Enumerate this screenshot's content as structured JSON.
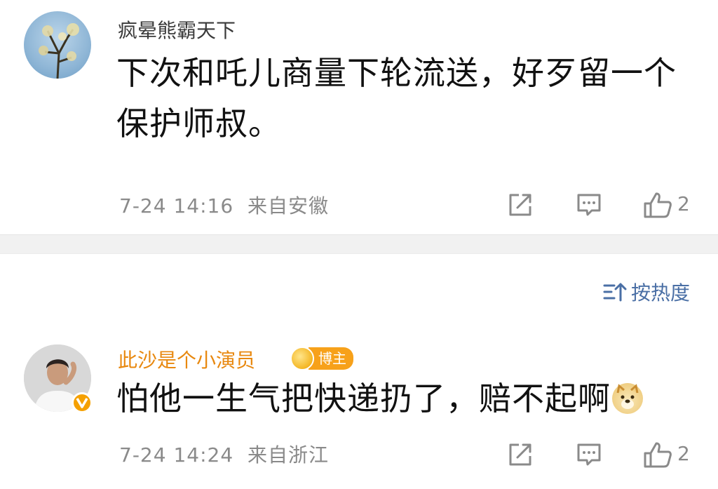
{
  "comments": [
    {
      "username": "疯晕熊霸天下",
      "content": "下次和吒儿商量下轮流送，好歹留一个保护师叔。",
      "timestamp": "7-24 14:16",
      "location": "来自安徽",
      "likes": "2",
      "avatar_icon": "tree-sky-avatar"
    },
    {
      "username": "此沙是个小演员",
      "badge": "博主",
      "content": "怕他一生气把快递扔了，赔不起啊",
      "emoji": "doge-emoji",
      "timestamp": "7-24 14:24",
      "location": "来自浙江",
      "likes": "2",
      "verified": "V",
      "avatar_icon": "person-avatar"
    }
  ],
  "sort": {
    "label": "按热度",
    "icon": "sort-icon"
  },
  "colors": {
    "username_default": "#3a3a3a",
    "username_blogger": "#e8880f",
    "meta": "#8a8a8a",
    "sort_link": "#4a6fa5",
    "badge": "#f7a11a",
    "divider": "#f1f1f1"
  }
}
